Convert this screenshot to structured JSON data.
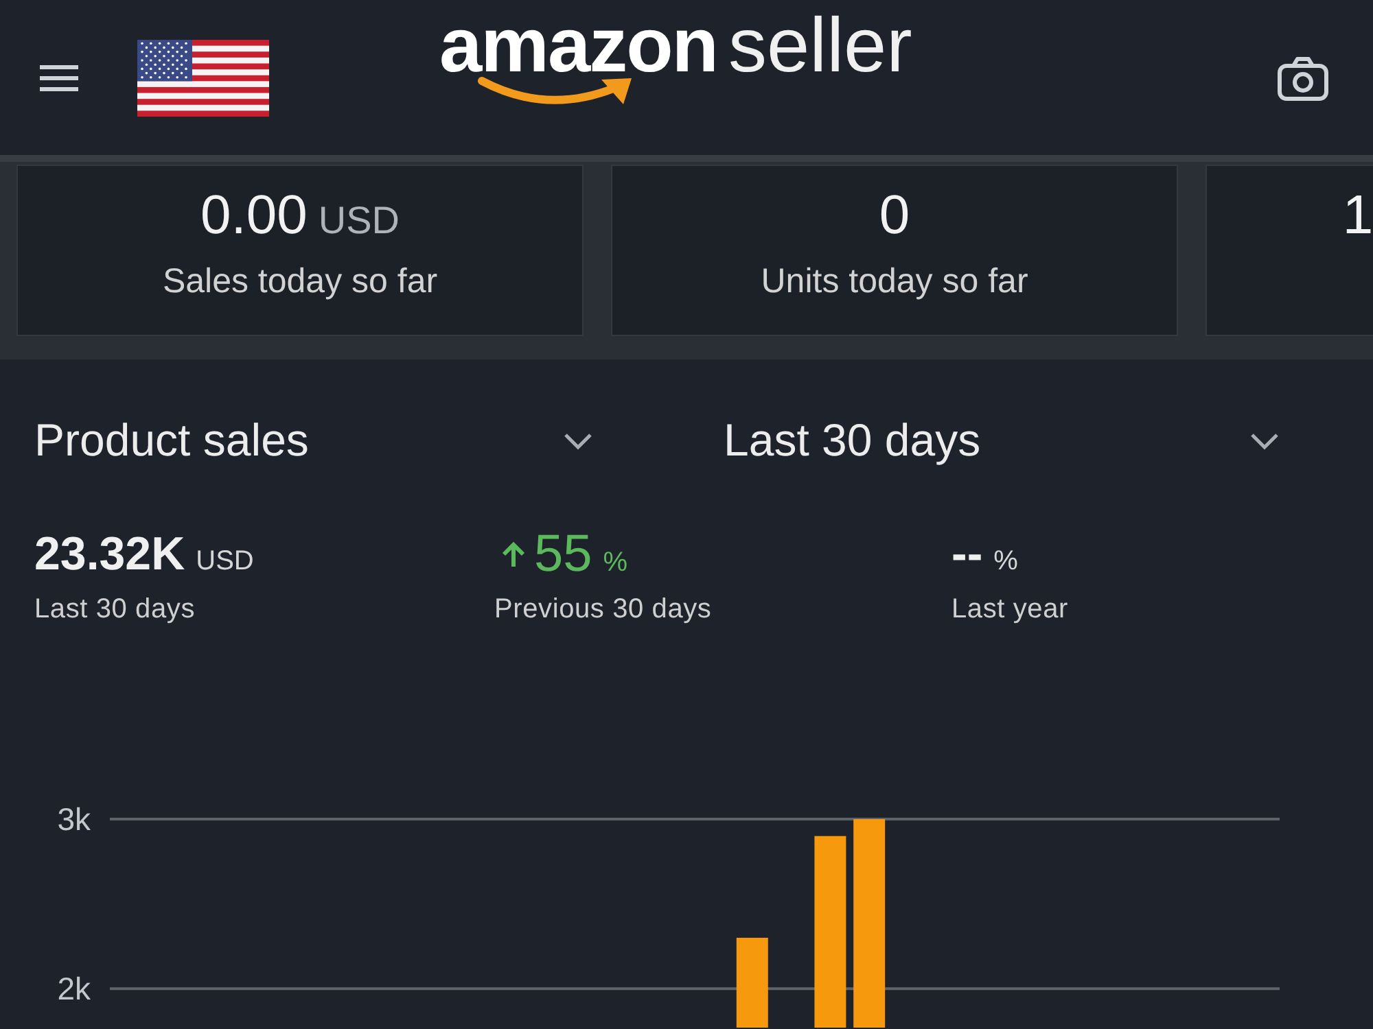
{
  "header": {
    "logo": {
      "wordmark": "amazon",
      "product": "seller"
    }
  },
  "summary_cards": [
    {
      "value": "0.00",
      "unit": "USD",
      "label": "Sales today so far"
    },
    {
      "value": "0",
      "label": "Units today so far"
    },
    {
      "value": "1"
    }
  ],
  "filters": [
    {
      "label": "Product sales"
    },
    {
      "label": "Last 30 days"
    }
  ],
  "metrics": [
    {
      "value": "23.32K",
      "unit": "USD",
      "rising": false,
      "label": "Last 30 days"
    },
    {
      "value": "55",
      "unit": "%",
      "rising": true,
      "label": "Previous 30 days"
    },
    {
      "value": "--",
      "unit": "%",
      "rising": false,
      "label": "Last year"
    }
  ],
  "sales_chart": {
    "chart_data": {
      "type": "bar",
      "values": [
        null,
        null,
        null,
        null,
        null,
        null,
        null,
        null,
        null,
        null,
        null,
        null,
        null,
        null,
        null,
        null,
        2300,
        null,
        2900,
        3000,
        null,
        null,
        null,
        null,
        null,
        null,
        null,
        null,
        null,
        null
      ],
      "ylim": [
        1770,
        3000
      ],
      "yticks": [
        {
          "value": 2000,
          "label": "2k"
        },
        {
          "value": 3000,
          "label": "3k"
        }
      ]
    }
  }
}
